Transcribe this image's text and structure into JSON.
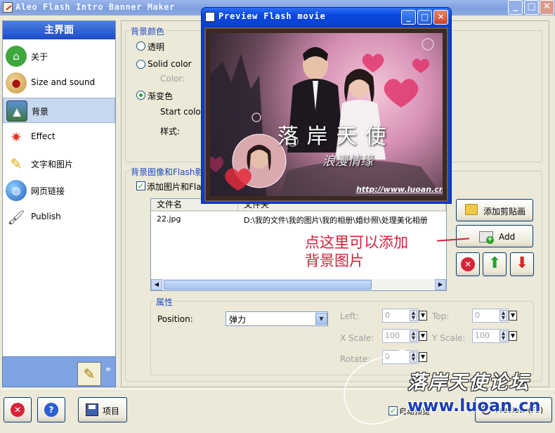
{
  "app": {
    "title": "Aleo Flash Intro Banner Maker"
  },
  "sidebar": {
    "header": "主界面",
    "items": [
      {
        "label": "关于",
        "icon": "home-icon"
      },
      {
        "label": "Size and sound",
        "icon": "palette-icon"
      },
      {
        "label": "背景",
        "icon": "background-image-icon",
        "selected": true
      },
      {
        "label": "Effect",
        "icon": "effect-icon"
      },
      {
        "label": "文字和图片",
        "icon": "pencil-icon"
      },
      {
        "label": "网页链接",
        "icon": "globe-icon"
      },
      {
        "label": "Publish",
        "icon": "brush-icon"
      }
    ]
  },
  "background_color": {
    "group_title": "背景颜色",
    "option_transparent": "透明",
    "option_solid": "Solid color",
    "color_label": "Color:",
    "option_gradient": "渐变色",
    "start_color_label": "Start color",
    "style_label": "样式:",
    "selected": "渐变色"
  },
  "background_image": {
    "group_title": "背景图像和Flash影",
    "add_checkbox_label": "添加图片和Fla",
    "add_checked": true,
    "columns": [
      "文件名",
      "文件夹"
    ],
    "rows": [
      {
        "filename": "22.jpg",
        "folder": "D:\\我的文件\\我的图片\\我的相册\\婚纱照\\处理美化相册"
      }
    ],
    "clipart_button": "添加剪贴画",
    "add_button": "Add"
  },
  "properties": {
    "group_title": "属性",
    "position_label": "Position:",
    "position_value": "弹力",
    "left_label": "Left:",
    "left_value": "0",
    "top_label": "Top:",
    "top_value": "0",
    "xscale_label": "X Scale:",
    "xscale_value": "100",
    "yscale_label": "Y Scale:",
    "yscale_value": "100",
    "rotate_label": "Rotate:",
    "rotate_value": "0"
  },
  "footer": {
    "project_button": "项目",
    "auto_preview_label": "自动预览",
    "auto_preview_checked": true,
    "preview_button": "Preview (F9)"
  },
  "preview_window": {
    "title": "Preview Flash movie",
    "movie_title": "落 岸 天 使",
    "movie_subtitle": "浪漫情缘",
    "movie_url": "http://www.luoan.cn/"
  },
  "annotation": {
    "line1": "点这里可以添加",
    "line2": "背景图片"
  },
  "watermark": {
    "forum_name": "落岸天使论坛",
    "site": "www.luoan.cn"
  },
  "colors": {
    "accent": "#1c48c0",
    "annotation_red": "#d4203a",
    "xp_blue": "#0a48dc",
    "selected_row": "#c7d8ef"
  }
}
